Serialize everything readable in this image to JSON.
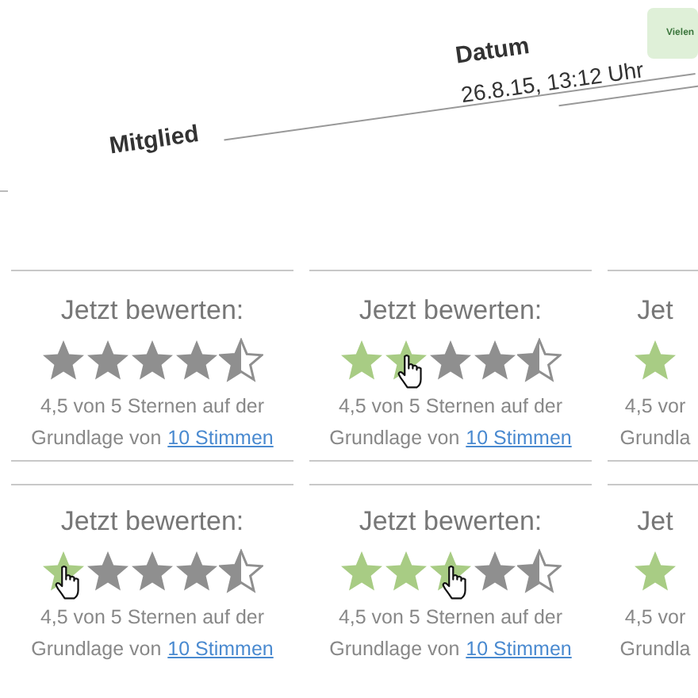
{
  "header": {
    "member_label": "Mitglied",
    "date_label": "Datum",
    "date_value": "26.8.15, 13:12 Uhr",
    "notice": "Vielen"
  },
  "widgets": [
    {
      "title": "Jetzt bewerten:",
      "stars": [
        {
          "kind": "full"
        },
        {
          "kind": "full"
        },
        {
          "kind": "full"
        },
        {
          "kind": "full"
        },
        {
          "kind": "half"
        }
      ],
      "cursor": false,
      "summary": "4,5 von 5 Sternen auf der",
      "basis": "Grundlage von",
      "link": "10 Stimmen"
    },
    {
      "title": "Jetzt bewerten:",
      "stars": [
        {
          "kind": "hover"
        },
        {
          "kind": "hover"
        },
        {
          "kind": "full"
        },
        {
          "kind": "full"
        },
        {
          "kind": "half"
        }
      ],
      "cursor": true,
      "summary": "4,5 von 5 Sternen auf der",
      "basis": "Grundlage von",
      "link": "10 Stimmen"
    },
    {
      "title": "Jet",
      "stars": [
        {
          "kind": "hover"
        }
      ],
      "cursor": false,
      "summary": "4,5 vor",
      "basis": "Grundla"
    },
    {
      "title": "Jetzt bewerten:",
      "stars": [
        {
          "kind": "hover"
        },
        {
          "kind": "full"
        },
        {
          "kind": "full"
        },
        {
          "kind": "full"
        },
        {
          "kind": "half"
        }
      ],
      "cursor": true,
      "summary": "4,5 von 5 Sternen auf der",
      "basis": "Grundlage von",
      "link": "10 Stimmen"
    },
    {
      "title": "Jetzt bewerten:",
      "stars": [
        {
          "kind": "hover"
        },
        {
          "kind": "hover"
        },
        {
          "kind": "hover"
        },
        {
          "kind": "full"
        },
        {
          "kind": "half"
        }
      ],
      "cursor": true,
      "summary": "4,5 von 5 Sternen auf der",
      "basis": "Grundlage von",
      "link": "10 Stimmen"
    },
    {
      "title": "Jet",
      "stars": [
        {
          "kind": "hover"
        }
      ],
      "cursor": false,
      "summary": "4,5 vor",
      "basis": "Grundla"
    }
  ]
}
